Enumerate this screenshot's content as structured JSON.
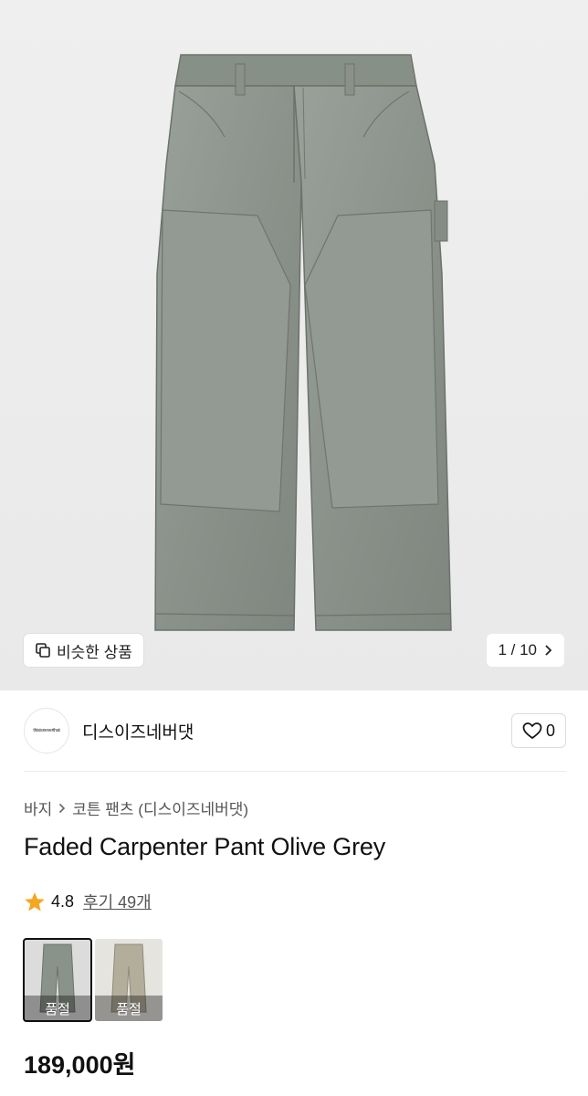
{
  "gallery": {
    "similar_label": "비슷한 상품",
    "pager_text": "1 / 10"
  },
  "brand": {
    "logo_text": "thisisneverthat",
    "name": "디스이즈네버댓",
    "like_count": "0"
  },
  "breadcrumb": {
    "category": "바지",
    "subcategory": "코튼 팬츠 (디스이즈네버댓)"
  },
  "product": {
    "title": "Faded Carpenter Pant Olive Grey",
    "rating": "4.8",
    "reviews": "후기 49개",
    "price": "189,000원"
  },
  "variants": [
    {
      "label": "품절",
      "color": "#8a9389"
    },
    {
      "label": "품절",
      "color": "#b3ad9c"
    }
  ],
  "colors": {
    "star": "#f5a623",
    "pants": "#8f968f"
  }
}
